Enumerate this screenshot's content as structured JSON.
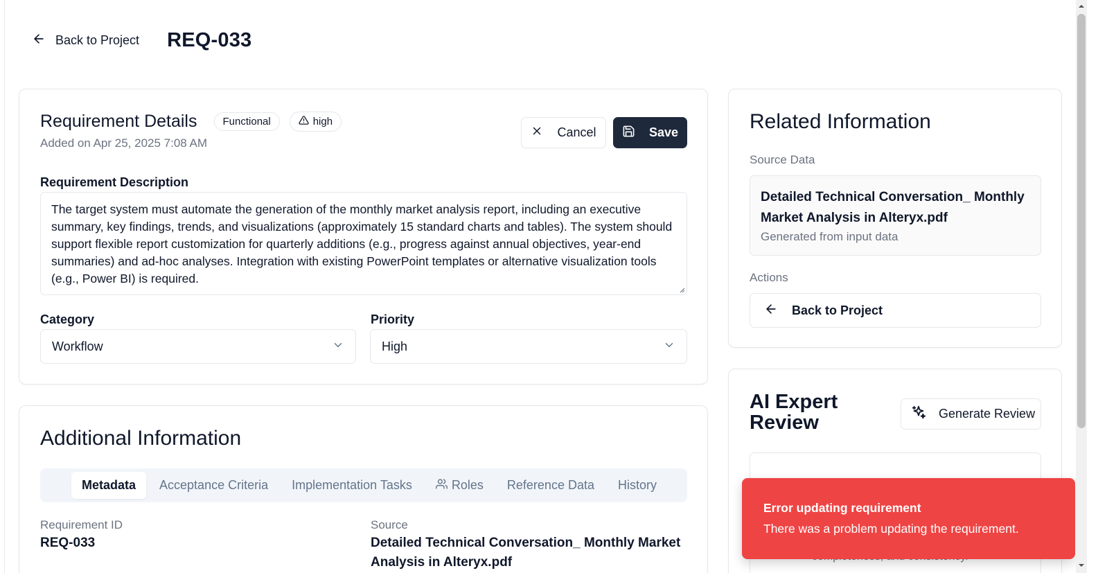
{
  "header": {
    "back_label": "Back to Project",
    "title": "REQ-033"
  },
  "details": {
    "title": "Requirement Details",
    "badge_category": "Functional",
    "badge_priority": "high",
    "added_on": "Added on Apr 25, 2025 7:08 AM",
    "cancel_label": "Cancel",
    "save_label": "Save",
    "description_label": "Requirement Description",
    "description": "The target system must automate the generation of the monthly market analysis report, including an executive summary, key findings, trends, and visualizations (approximately 15 standard charts and tables). The system should support flexible report customization for quarterly additions (e.g., progress against annual objectives, year-end summaries) and ad-hoc analyses. Integration with existing PowerPoint templates or alternative visualization tools (e.g., Power BI) is required.",
    "category_label": "Category",
    "category_value": "Workflow",
    "priority_label": "Priority",
    "priority_value": "High"
  },
  "additional": {
    "title": "Additional Information",
    "tabs": [
      {
        "label": "Metadata",
        "active": true
      },
      {
        "label": "Acceptance Criteria",
        "active": false
      },
      {
        "label": "Implementation Tasks",
        "active": false
      },
      {
        "label": "Roles",
        "active": false,
        "icon": "users-icon"
      },
      {
        "label": "Reference Data",
        "active": false
      },
      {
        "label": "History",
        "active": false
      }
    ],
    "req_id_label": "Requirement ID",
    "req_id_value": "REQ-033",
    "source_label": "Source",
    "source_value": "Detailed Technical Conversation_ Monthly Market Analysis in Alteryx.pdf"
  },
  "related": {
    "title": "Related Information",
    "source_data_label": "Source Data",
    "source_name": "Detailed Technical Conversation_ Monthly Market Analysis in Alteryx.pdf",
    "source_sub": "Generated from input data",
    "actions_label": "Actions",
    "back_label": "Back to Project"
  },
  "ai_review": {
    "title": "AI Expert Review",
    "generate_label": "Generate Review",
    "peek_text": "completeness, and consistency."
  },
  "toast": {
    "title": "Error updating requirement",
    "message": "There was a problem updating the requirement.",
    "color": "#ef4444"
  },
  "colors": {
    "primary_button": "#1e293b",
    "border": "#e5e7eb",
    "muted_text": "#6b7280"
  }
}
